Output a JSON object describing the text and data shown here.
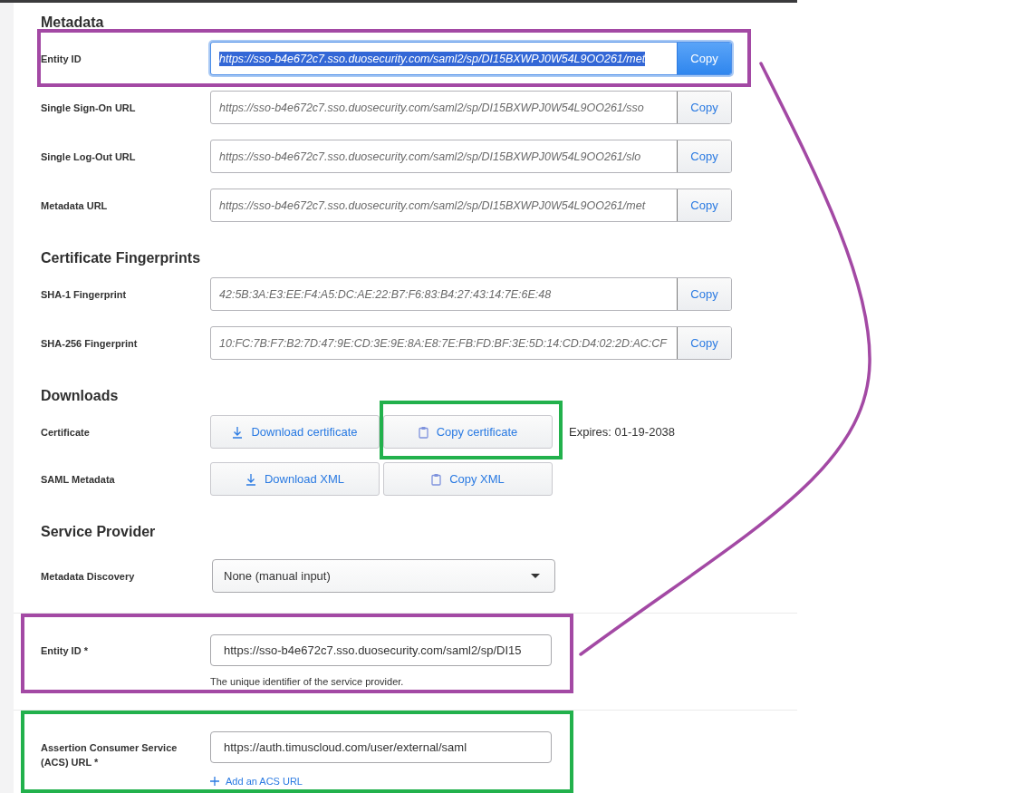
{
  "sections": [
    {
      "title": "Metadata",
      "rows": [
        {
          "kind": "copy_field",
          "label": "Entity ID",
          "value": "https://sso-b4e672c7.sso.duosecurity.com/saml2/sp/DI15BXWPJ0W54L9OO261/met",
          "button": "Copy",
          "focused": true,
          "highlight": {
            "color": "#a349a4"
          }
        },
        {
          "kind": "copy_field",
          "label": "Single Sign-On URL",
          "value": "https://sso-b4e672c7.sso.duosecurity.com/saml2/sp/DI15BXWPJ0W54L9OO261/sso",
          "button": "Copy",
          "focused": false
        },
        {
          "kind": "copy_field",
          "label": "Single Log-Out URL",
          "value": "https://sso-b4e672c7.sso.duosecurity.com/saml2/sp/DI15BXWPJ0W54L9OO261/slo",
          "button": "Copy",
          "focused": false
        },
        {
          "kind": "copy_field",
          "label": "Metadata URL",
          "value": "https://sso-b4e672c7.sso.duosecurity.com/saml2/sp/DI15BXWPJ0W54L9OO261/met",
          "button": "Copy",
          "focused": false
        }
      ]
    },
    {
      "title": "Certificate Fingerprints",
      "rows": [
        {
          "kind": "copy_field",
          "label": "SHA-1 Fingerprint",
          "value": "42:5B:3A:E3:EE:F4:A5:DC:AE:22:B7:F6:83:B4:27:43:14:7E:6E:48",
          "button": "Copy",
          "focused": false
        },
        {
          "kind": "copy_field",
          "label": "SHA-256 Fingerprint",
          "value": "10:FC:7B:F7:B2:7D:47:9E:CD:3E:9E:8A:E8:7E:FB:FD:BF:3E:5D:14:CD:D4:02:2D:AC:CF",
          "button": "Copy",
          "focused": false
        }
      ]
    },
    {
      "title": "Downloads",
      "rows": [
        {
          "kind": "buttons",
          "label": "Certificate",
          "buttons": [
            {
              "label": "Download certificate"
            },
            {
              "label": "Copy certificate",
              "highlight": {
                "color": "#22b14c"
              }
            }
          ],
          "note": "Expires: 01-19-2038"
        },
        {
          "kind": "buttons",
          "label": "SAML Metadata",
          "buttons": [
            {
              "label": "Download XML"
            },
            {
              "label": "Copy XML"
            }
          ]
        }
      ]
    },
    {
      "title": "Service Provider",
      "rows": [
        {
          "kind": "select",
          "label": "Metadata Discovery",
          "value": "None (manual input)"
        },
        {
          "kind": "text_field",
          "label": "Entity ID *",
          "value": "https://sso-b4e672c7.sso.duosecurity.com/saml2/sp/DI15",
          "help": "The unique identifier of the service provider.",
          "highlight": {
            "color": "#a349a4"
          }
        },
        {
          "kind": "text_field",
          "label": "Assertion Consumer Service (ACS) URL *",
          "value": "https://auth.timuscloud.com/user/external/saml",
          "link": "Add an ACS URL",
          "highlight": {
            "color": "#22b14c"
          }
        }
      ]
    }
  ],
  "connector": {
    "color": "#a349a4"
  }
}
